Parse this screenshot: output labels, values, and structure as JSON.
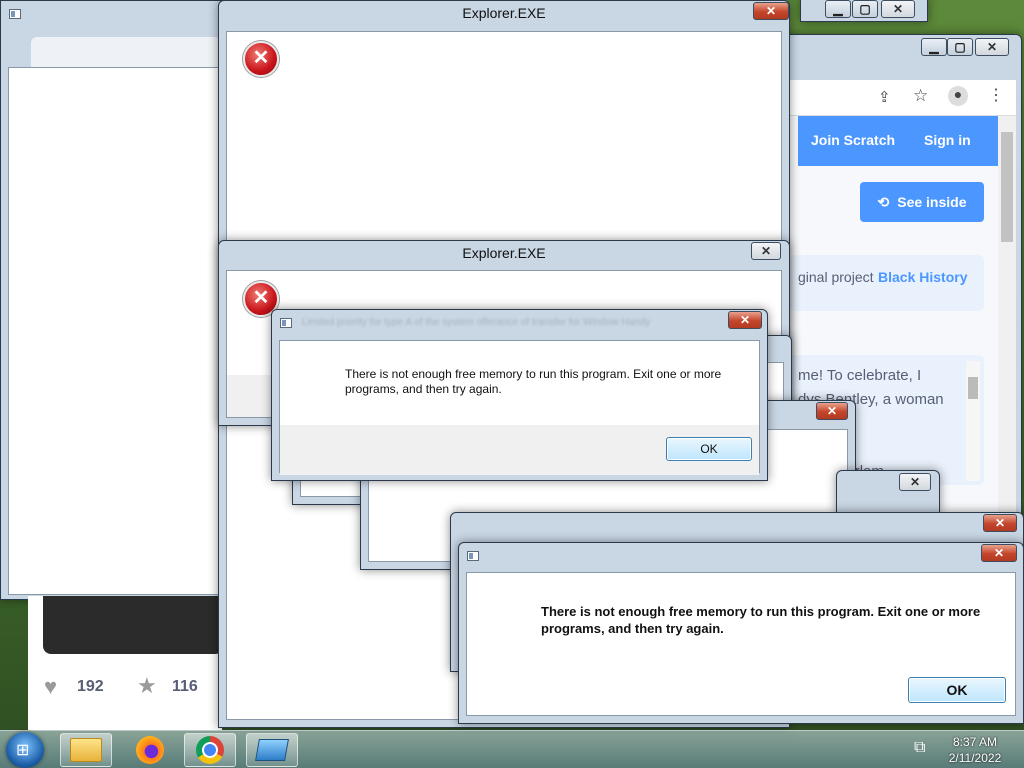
{
  "browser": {
    "nav": {
      "join_label": "Join Scratch",
      "signin_label": "Sign in"
    },
    "see_inside_label": "See inside",
    "original_prefix": "ginal project",
    "original_link": "Black History",
    "notes_line1": "me! To celebrate, I",
    "notes_line2": "dys Bentley, a woman",
    "notes_line3": "g the Harlem",
    "loves_count": "192",
    "favorites_count": "116"
  },
  "dialogs": {
    "explorer_title": "Explorer.EXE",
    "error_message": "There is not enough free memory to run this program. Exit one or more programs, and then try again.",
    "ok_label": "OK",
    "blurred_title": "Limited priority for type A of the system offerance of transfer for Window Handy"
  },
  "taskbar": {
    "time": "8:37 AM",
    "date": "2/11/2022",
    "apps": [
      "file-explorer",
      "firefox",
      "chrome",
      "remote-desktop"
    ]
  },
  "colors": {
    "scratch_blue": "#4c97ff",
    "error_red": "#c8141b",
    "close_red": "#c4452b"
  }
}
